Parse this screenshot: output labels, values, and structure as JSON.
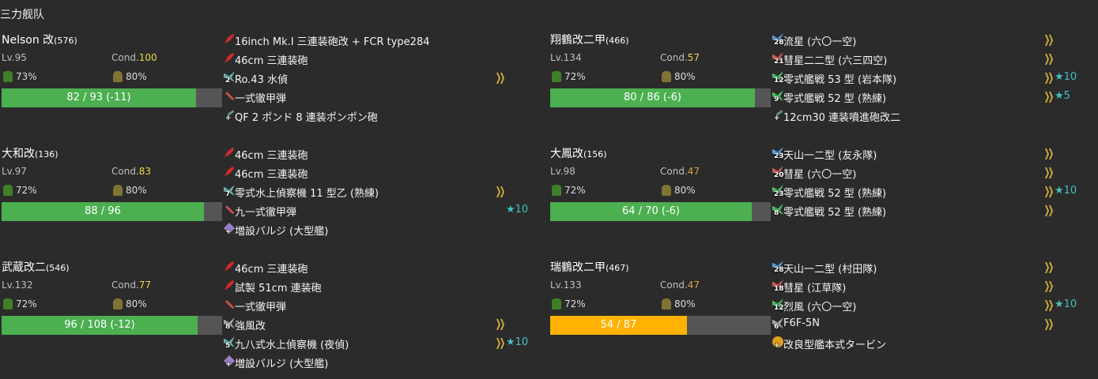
{
  "fleet_title": "三力舰队",
  "colors": {
    "hp_green": "#4caf50",
    "hp_orange": "#ffb300",
    "cond_yellow": "#e8d84a",
    "cond_orange": "#d9a441",
    "star": "#45c0c0",
    "proficiency": "#d4b03a"
  },
  "columns": [
    {
      "ships": [
        {
          "name": "Nelson 改",
          "id": "(576)",
          "lv": "Lv.95",
          "cond_label": "Cond.",
          "cond": "100",
          "cond_color": "#e8d84a",
          "fuel": "73%",
          "ammo": "80%",
          "hp_text": "82 / 93 (-11)",
          "hp_fraction": 0.882,
          "hp_color": "#4caf50",
          "equips": [
            {
              "icon": "icon-gun",
              "badge": "",
              "name": "16inch Mk.I 三連装砲改 + FCR type284",
              "prof": false,
              "star": ""
            },
            {
              "icon": "icon-gun",
              "badge": "",
              "name": "46cm 三連装砲",
              "prof": false,
              "star": ""
            },
            {
              "icon": "icon-plane-teal",
              "badge": "2",
              "name": "Ro.43 水偵",
              "prof": true,
              "star": ""
            },
            {
              "icon": "icon-shell",
              "badge": "",
              "name": "一式徹甲弾",
              "prof": false,
              "star": ""
            },
            {
              "icon": "icon-aa",
              "badge": "+",
              "name": "QF 2 ポンド 8 連装ポンポン砲",
              "prof": false,
              "star": ""
            }
          ]
        },
        {
          "name": "大和改",
          "id": "(136)",
          "lv": "Lv.97",
          "cond_label": "Cond.",
          "cond": "83",
          "cond_color": "#e8d84a",
          "fuel": "72%",
          "ammo": "80%",
          "hp_text": "88 / 96",
          "hp_fraction": 0.917,
          "hp_color": "#4caf50",
          "equips": [
            {
              "icon": "icon-gun",
              "badge": "",
              "name": "46cm 三連装砲",
              "prof": false,
              "star": ""
            },
            {
              "icon": "icon-gun",
              "badge": "",
              "name": "46cm 三連装砲",
              "prof": false,
              "star": ""
            },
            {
              "icon": "icon-plane-teal",
              "badge": "7",
              "name": "零式水上偵察機 11 型乙 (熟練)",
              "prof": true,
              "star": ""
            },
            {
              "icon": "icon-shell",
              "badge": "",
              "name": "九一式徹甲弾",
              "prof": false,
              "star": "★10"
            },
            {
              "icon": "icon-bulge",
              "badge": "+",
              "name": "増設バルジ (大型艦)",
              "prof": false,
              "star": ""
            }
          ]
        },
        {
          "name": "武蔵改二",
          "id": "(546)",
          "lv": "Lv.132",
          "cond_label": "Cond.",
          "cond": "77",
          "cond_color": "#e8d84a",
          "fuel": "72%",
          "ammo": "80%",
          "hp_text": "96 / 108 (-12)",
          "hp_fraction": 0.889,
          "hp_color": "#4caf50",
          "equips": [
            {
              "icon": "icon-gun",
              "badge": "",
              "name": "46cm 三連装砲",
              "prof": false,
              "star": ""
            },
            {
              "icon": "icon-gun",
              "badge": "",
              "name": "試製 51cm 連装砲",
              "prof": false,
              "star": ""
            },
            {
              "icon": "icon-shell",
              "badge": "",
              "name": "一式徹甲弾",
              "prof": false,
              "star": ""
            },
            {
              "icon": "icon-plane-gray",
              "badge": "8",
              "name": "強風改",
              "prof": true,
              "star": ""
            },
            {
              "icon": "icon-plane-teal",
              "badge": "5",
              "name": "九八式水上偵察機 (夜偵)",
              "prof": true,
              "star": "★10"
            },
            {
              "icon": "icon-bulge",
              "badge": "+",
              "name": "増設バルジ (大型艦)",
              "prof": false,
              "star": ""
            }
          ]
        }
      ]
    },
    {
      "ships": [
        {
          "name": "翔鶴改二甲",
          "id": "(466)",
          "lv": "Lv.134",
          "cond_label": "Cond.",
          "cond": "57",
          "cond_color": "#e8d84a",
          "fuel": "72%",
          "ammo": "80%",
          "hp_text": "80 / 86 (-6)",
          "hp_fraction": 0.93,
          "hp_color": "#4caf50",
          "equips": [
            {
              "icon": "icon-plane-blue",
              "badge": "28",
              "name": "流星 (六〇一空)",
              "prof": true,
              "star": ""
            },
            {
              "icon": "icon-plane-red",
              "badge": "21",
              "name": "彗星二二型 (六三四空)",
              "prof": true,
              "star": ""
            },
            {
              "icon": "icon-plane-green",
              "badge": "12",
              "name": "零式艦戦 53 型 (岩本隊)",
              "prof": true,
              "star": "★10"
            },
            {
              "icon": "icon-plane-green",
              "badge": "9",
              "name": "零式艦戦 52 型 (熟練)",
              "prof": true,
              "star": "★5"
            },
            {
              "icon": "icon-aa",
              "badge": "+",
              "name": "12cm30 連装噴進砲改二",
              "prof": false,
              "star": ""
            }
          ]
        },
        {
          "name": "大鳳改",
          "id": "(156)",
          "lv": "Lv.98",
          "cond_label": "Cond.",
          "cond": "47",
          "cond_color": "#d9a441",
          "fuel": "72%",
          "ammo": "80%",
          "hp_text": "64 / 70 (-6)",
          "hp_fraction": 0.914,
          "hp_color": "#4caf50",
          "equips": [
            {
              "icon": "icon-plane-blue",
              "badge": "23",
              "name": "天山一二型 (友永隊)",
              "prof": true,
              "star": ""
            },
            {
              "icon": "icon-plane-red",
              "badge": "20",
              "name": "彗星 (六〇一空)",
              "prof": true,
              "star": ""
            },
            {
              "icon": "icon-plane-green",
              "badge": "23",
              "name": "零式艦戦 52 型 (熟練)",
              "prof": true,
              "star": "★10"
            },
            {
              "icon": "icon-plane-green",
              "badge": "8",
              "name": "零式艦戦 52 型 (熟練)",
              "prof": true,
              "star": ""
            }
          ]
        },
        {
          "name": "瑞鶴改二甲",
          "id": "(467)",
          "lv": "Lv.133",
          "cond_label": "Cond.",
          "cond": "47",
          "cond_color": "#d9a441",
          "fuel": "72%",
          "ammo": "80%",
          "hp_text": "54 / 87",
          "hp_fraction": 0.621,
          "hp_color": "#ffb300",
          "equips": [
            {
              "icon": "icon-plane-blue",
              "badge": "28",
              "name": "天山一二型 (村田隊)",
              "prof": true,
              "star": ""
            },
            {
              "icon": "icon-plane-red",
              "badge": "18",
              "name": "彗星 (江草隊)",
              "prof": true,
              "star": ""
            },
            {
              "icon": "icon-plane-green",
              "badge": "12",
              "name": "烈風 (六〇一空)",
              "prof": true,
              "star": "★10"
            },
            {
              "icon": "icon-plane-gray",
              "badge": "6",
              "name": "F6F-5N",
              "prof": true,
              "star": ""
            },
            {
              "icon": "icon-turbine",
              "badge": "+",
              "name": "改良型艦本式タービン",
              "prof": false,
              "star": ""
            }
          ]
        }
      ]
    }
  ]
}
